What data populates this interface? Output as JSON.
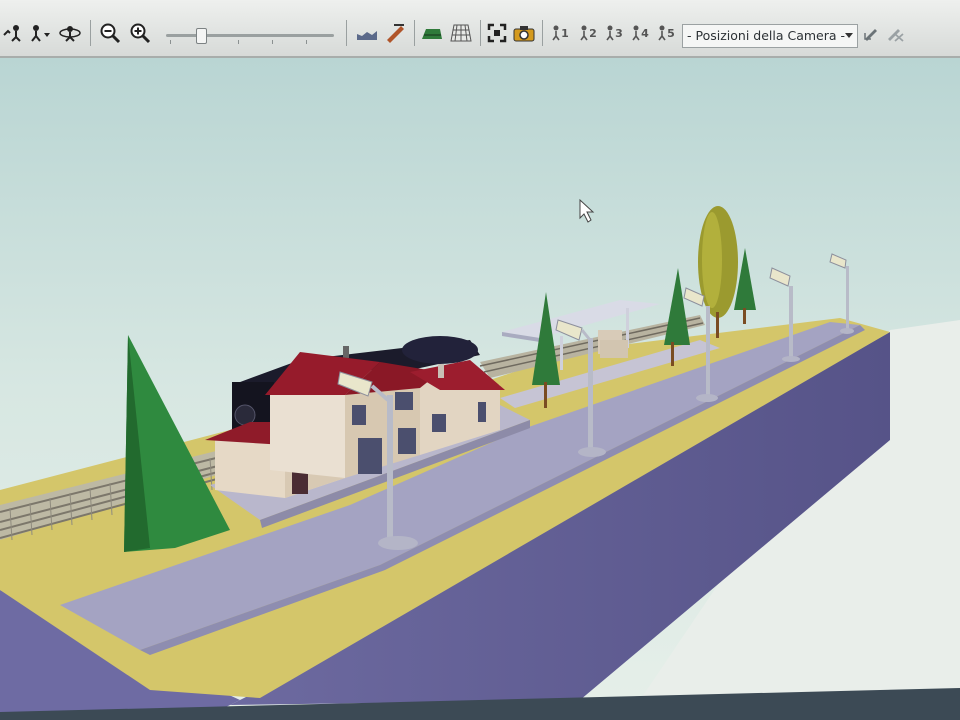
{
  "toolbar": {
    "tools": [
      {
        "name": "walk-camera-icon"
      },
      {
        "name": "camera-mode-dropdown-icon"
      },
      {
        "name": "orbit-camera-icon"
      },
      {
        "name": "zoom-out-icon"
      },
      {
        "name": "zoom-in-icon"
      },
      {
        "name": "terrain-icon"
      },
      {
        "name": "track-pen-icon"
      },
      {
        "name": "green-terrain-icon"
      },
      {
        "name": "grid-icon"
      },
      {
        "name": "fit-view-icon"
      },
      {
        "name": "screenshot-camera-icon"
      }
    ],
    "zoom_slider": {
      "value_fraction": 0.2
    },
    "camera_positions": [
      "1",
      "2",
      "3",
      "4",
      "5"
    ],
    "camera_select_value": "- Posizioni della Camera -",
    "save_camera_icon": "pen-icon",
    "delete_camera_icon": "pen-delete-icon"
  },
  "scene": {
    "sky_color": "#d3e3df",
    "ground_color": "#d4c66a",
    "road_color": "#a4a3c2",
    "base_side_color": "#625f92",
    "roof_color": "#8f1b29",
    "wall_color": "#e0d4c3",
    "tree_color": "#2f7a3a"
  }
}
